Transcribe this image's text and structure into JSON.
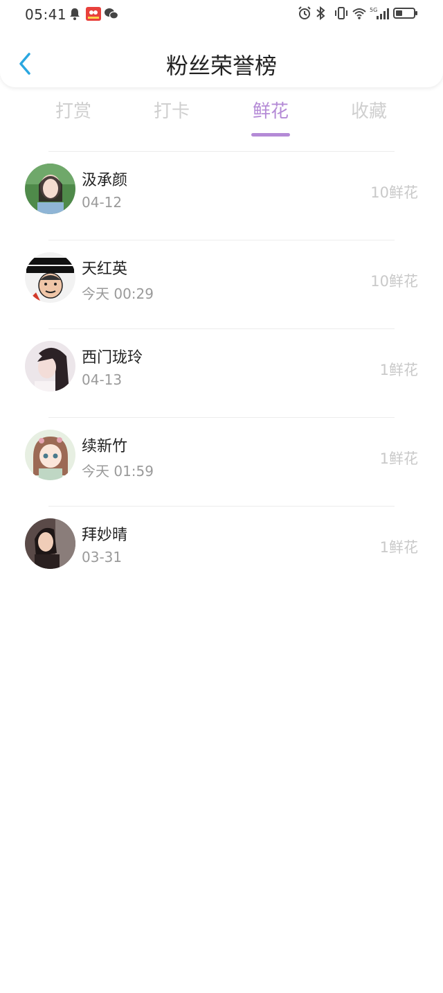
{
  "status_bar": {
    "time": "05:41",
    "network": "5G"
  },
  "header": {
    "title": "粉丝荣誉榜"
  },
  "tabs": [
    {
      "label": "打赏",
      "active": false
    },
    {
      "label": "打卡",
      "active": false
    },
    {
      "label": "鲜花",
      "active": true
    },
    {
      "label": "收藏",
      "active": false
    }
  ],
  "colors": {
    "accent": "#b48ad6",
    "back_arrow": "#2aa7e0"
  },
  "ranking": [
    {
      "name": "汲承颜",
      "time": "04-12",
      "amount": "10鲜花"
    },
    {
      "name": "天红英",
      "time": "今天 00:29",
      "amount": "10鲜花"
    },
    {
      "name": "西门珑玲",
      "time": "04-13",
      "amount": "1鲜花"
    },
    {
      "name": "续新竹",
      "time": "今天 01:59",
      "amount": "1鲜花"
    },
    {
      "name": "拜妙晴",
      "time": "03-31",
      "amount": "1鲜花"
    }
  ]
}
